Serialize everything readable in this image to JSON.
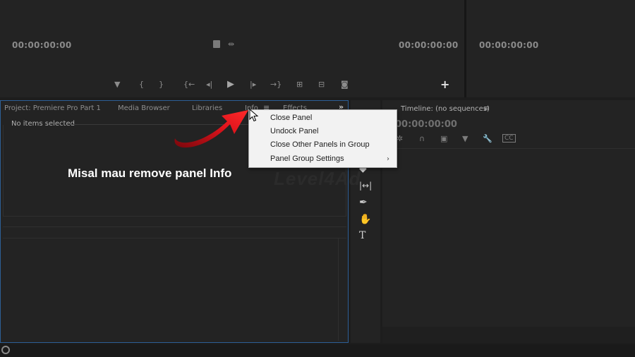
{
  "source_monitor": {
    "timecode_left": "00:00:00:00",
    "timecode_right": "00:00:00:00",
    "controls": [
      "marker-icon",
      "mark-in-icon",
      "mark-out-icon",
      "go-to-in-icon",
      "step-back-icon",
      "play-icon",
      "step-forward-icon",
      "go-to-out-icon",
      "insert-icon",
      "overwrite-icon",
      "export-frame-icon"
    ],
    "add_button": "+"
  },
  "program_monitor": {
    "timecode": "00:00:00:00"
  },
  "project_panel": {
    "tabs": [
      {
        "label": "Project: Premiere Pro Part 1"
      },
      {
        "label": "Media Browser"
      },
      {
        "label": "Libraries"
      },
      {
        "label": "Info"
      },
      {
        "label": "Effects"
      }
    ],
    "menu_icon": "≡",
    "overflow_icon": "»",
    "status": "No items selected"
  },
  "context_menu": {
    "items": [
      {
        "label": "Close Panel"
      },
      {
        "label": "Undock Panel"
      },
      {
        "label": "Close Other Panels in Group"
      },
      {
        "label": "Panel Group Settings",
        "has_submenu": true
      }
    ],
    "submenu_arrow": "›"
  },
  "tools_panel": {
    "tools": [
      "razor-icon",
      "slip-icon",
      "pen-icon",
      "hand-icon",
      "type-icon"
    ]
  },
  "timeline_panel": {
    "title": "Timeline: (no sequences)",
    "menu_icon": "≡",
    "timecode": "00:00:00:00"
  },
  "annotation": {
    "text": "Misal mau remove panel Info",
    "arrow_color": "#d9141c"
  },
  "watermark": {
    "text": "Level4Ad"
  },
  "colors": {
    "panel_bg": "#232323",
    "active_border": "#2d5f96",
    "menu_bg": "#f2f2f2"
  }
}
